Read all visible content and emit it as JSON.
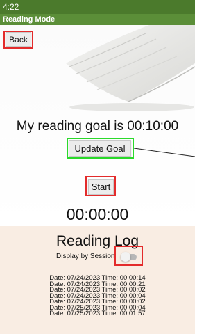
{
  "status_bar": {
    "time": "4:22"
  },
  "title_bar": {
    "title": "Reading Mode"
  },
  "buttons": {
    "back": "Back",
    "update_goal": "Update Goal",
    "start": "Start"
  },
  "goal": {
    "text": "My reading goal is 00:10:00"
  },
  "timer": {
    "value": "00:00:00"
  },
  "reading_log": {
    "title": "Reading Log",
    "toggle_label": "Display by Session",
    "toggle_on": false,
    "entries": [
      "Date: 07/24/2023 Time: 00:00:14",
      "Date: 07/24/2023 Time: 00:00:21",
      "Date: 07/24/2023 Time: 00:00:02",
      "Date: 07/24/2023 Time: 00:00:04",
      "Date: 07/24/2023 Time: 00:00:02",
      "Date: 07/25/2023 Time: 00:00:04",
      "Date: 07/25/2023 Time: 00:01:57"
    ]
  },
  "colors": {
    "status_bar": "#4b7a2c",
    "title_bar": "#5b8e38",
    "highlight_red": "#e32b2b",
    "highlight_green": "#2bd92b",
    "log_background": "#f9ede3"
  }
}
